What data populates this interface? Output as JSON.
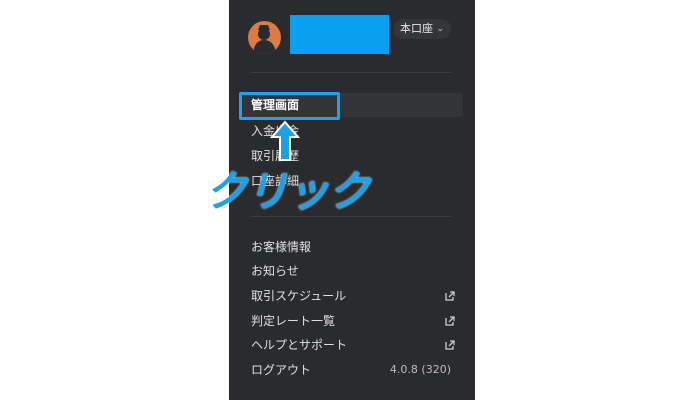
{
  "header": {
    "account_label": "本口座",
    "chevron_icon": "chevron-down-icon"
  },
  "menu_primary": [
    {
      "label": "管理画面",
      "active": true
    },
    {
      "label": "入金出金"
    },
    {
      "label": "取引履歴"
    },
    {
      "label": "口座詳細"
    }
  ],
  "menu_secondary": [
    {
      "label": "お客様情報"
    },
    {
      "label": "お知らせ"
    },
    {
      "label": "取引スケジュール",
      "icon": "external-link-icon"
    },
    {
      "label": "判定レート一覧",
      "icon": "external-link-icon"
    },
    {
      "label": "ヘルプとサポート",
      "icon": "external-link-icon"
    },
    {
      "label": "ログアウト",
      "meta": "4.0.8 (320)"
    }
  ],
  "annotation": {
    "click_label": "クリック",
    "accent_color": "#1aa5f0"
  }
}
